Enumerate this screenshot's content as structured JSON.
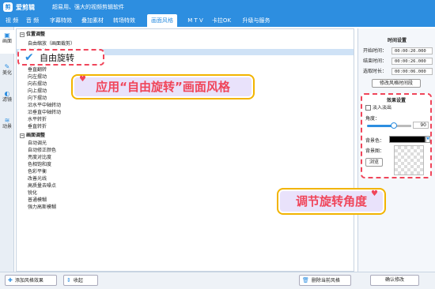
{
  "app": {
    "logo_text": "剪",
    "name": "爱剪辑",
    "slogan": "超易用、强大的视频剪辑软件"
  },
  "menu": [
    {
      "label": "视 频"
    },
    {
      "label": "音 频"
    },
    {
      "label": "字幕特效"
    },
    {
      "label": "叠加素材"
    },
    {
      "label": "转场特效"
    },
    {
      "label": "画面风格"
    },
    {
      "label": "M T V"
    },
    {
      "label": "卡拉OK"
    },
    {
      "label": "升级与服务"
    }
  ],
  "active_menu": "画面风格",
  "sidebar": [
    {
      "icon": "▣",
      "label": "画面"
    },
    {
      "icon": "✎",
      "label": "美化"
    },
    {
      "icon": "◐",
      "label": "滤镜"
    },
    {
      "icon": "≋",
      "label": "动景"
    }
  ],
  "tree": {
    "groups": [
      {
        "label": "位置调整",
        "items": [
          "自由缩放（画面裁剪）",
          "自由旋转",
          "垂直翻转",
          "向左摆动",
          "向右摆动",
          "向上摆动",
          "向下摆动",
          "沿水平中轴转动",
          "沿垂直中轴转动",
          "水平转折",
          "垂直转折"
        ]
      },
      {
        "label": "画面调整",
        "items": [
          "自动调光",
          "自动修正颜色",
          "亮度对比度",
          "色相饱和度",
          "色彩平衡",
          "改善光线",
          "高质量去噪点",
          "锐化",
          "普通模糊",
          "强力高斯模糊"
        ]
      }
    ],
    "selected_item": "自由旋转"
  },
  "callouts": {
    "apply_style": "应用“自由旋转”画面风格",
    "adjust_angle": "调节旋转角度"
  },
  "time_settings": {
    "title": "时间设置",
    "start_label": "开始时间：",
    "start_value": "00:00:20.000",
    "end_label": "结束时间：",
    "end_value": "00:00:26.000",
    "duration_label": "选取时长：",
    "duration_value": "00:00:06.000",
    "modify_button": "修改风格时间段"
  },
  "effect_settings": {
    "title": "效果设置",
    "fade_label": "淡入淡出",
    "fade_checked": false,
    "angle_label": "角度：",
    "angle_value": "90",
    "angle_fraction": 0.6,
    "bg_color_label": "背景色：",
    "bg_color": "#000000",
    "bg_image_label": "背景图：",
    "browse_button": "浏览"
  },
  "bottom": {
    "add_style_button": "添加风格效果",
    "collapse_button": "收起",
    "delete_style_button": "删除当前风格",
    "confirm_button": "确认修改"
  }
}
